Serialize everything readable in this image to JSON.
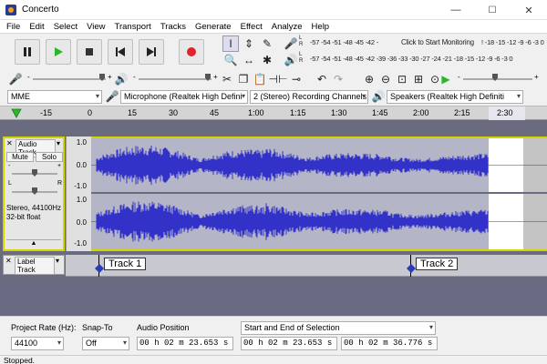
{
  "window": {
    "title": "Concerto",
    "minimize": "—",
    "maximize": "☐",
    "close": "✕"
  },
  "menu": [
    "File",
    "Edit",
    "Select",
    "View",
    "Transport",
    "Tracks",
    "Generate",
    "Effect",
    "Analyze",
    "Help"
  ],
  "meters": {
    "record_scale": "-57 -54 -51 -48 -45 -42 -",
    "record_prompt": "Click to Start Monitoring",
    "record_scale_right": "! -18 -15 -12 -9 -6 -3 0",
    "play_scale": "-57 -54 -51 -48 -45 -42 -39 -36 -33 -30 -27 -24 -21 -18 -15 -12 -9 -6 -3 0"
  },
  "devices": {
    "host": "MME",
    "recording_device": "Microphone (Realtek High Defini",
    "channels": "2 (Stereo) Recording Channels",
    "playback_device": "Speakers (Realtek High Definiti"
  },
  "timeline": {
    "labels": [
      "-15",
      "0",
      "15",
      "30",
      "45",
      "1:00",
      "1:15",
      "1:30",
      "1:45",
      "2:00",
      "2:15",
      "2:30"
    ]
  },
  "audio_track": {
    "name": "Audio Track",
    "mute": "Mute",
    "solo": "Solo",
    "gain_minus": "-",
    "gain_plus": "+",
    "pan_left": "L",
    "pan_right": "R",
    "info_line1": "Stereo, 44100Hz",
    "info_line2": "32-bit float",
    "scale_top": [
      "1.0",
      "0.0",
      "-1.0"
    ],
    "scale_bottom": [
      "1.0",
      "0.0",
      "-1.0"
    ]
  },
  "label_track": {
    "name": "Label Track",
    "labels": [
      "Track 1",
      "Track 2"
    ]
  },
  "bottom": {
    "project_rate_label": "Project Rate (Hz):",
    "project_rate_value": "44100",
    "snap_to_label": "Snap-To",
    "snap_to_value": "Off",
    "audio_position_label": "Audio Position",
    "audio_position_value": "00 h 02 m 23.653 s",
    "selection_label": "Start and End of Selection",
    "selection_start": "00 h 02 m 23.653 s",
    "selection_end": "00 h 02 m 36.776 s"
  },
  "status": "Stopped.",
  "colors": {
    "waveform": "#3232c8",
    "wave_bg": "#b5b5c8",
    "selection": "#ffffff",
    "play": "#2db52d",
    "record": "#e0242b"
  }
}
